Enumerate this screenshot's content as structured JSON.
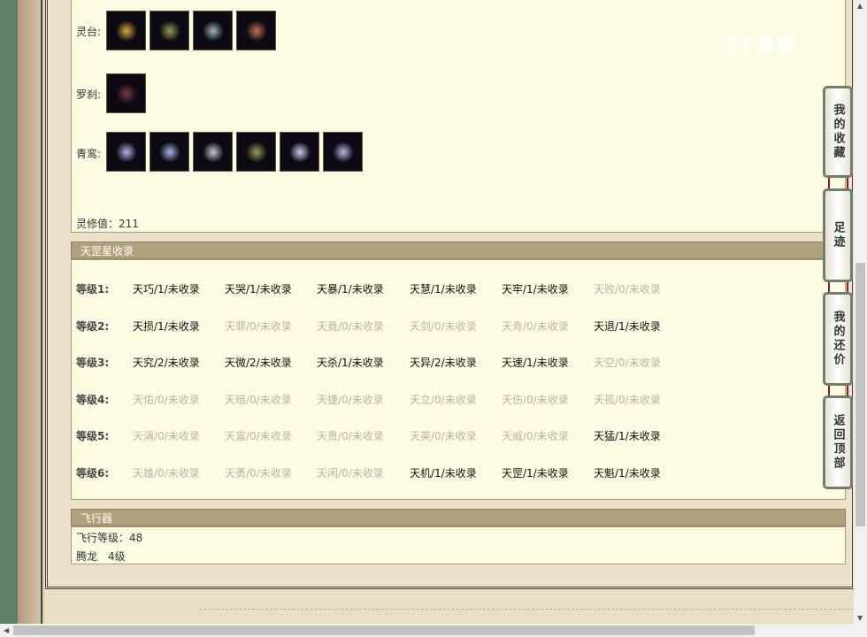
{
  "watermark": "CC直播",
  "lingtai": {
    "label": "灵台:",
    "icons": [
      "crown-icon",
      "mask-icon",
      "cloak-icon",
      "pendant-icon"
    ]
  },
  "luosha": {
    "label": "罗刹:",
    "icons": [
      "bag-icon"
    ]
  },
  "qingluan": {
    "label": "青鸾:",
    "icons": [
      "wing-icon",
      "robe-icon",
      "ring-icon",
      "mask-icon",
      "tassel-icon",
      "belt-icon"
    ]
  },
  "lingxiu": "灵修值：211",
  "tiangang": {
    "title": "天罡星收录",
    "rows": [
      {
        "label": "等级1:",
        "cells": [
          {
            "t": "天巧/1/未收录",
            "c": 1
          },
          {
            "t": "天哭/1/未收录",
            "c": 1
          },
          {
            "t": "天暴/1/未收录",
            "c": 1
          },
          {
            "t": "天慧/1/未收录",
            "c": 1
          },
          {
            "t": "天牢/1/未收录",
            "c": 1
          },
          {
            "t": "天败/0/未收录",
            "c": 0
          }
        ]
      },
      {
        "label": "等级2:",
        "cells": [
          {
            "t": "天损/1/未收录",
            "c": 1
          },
          {
            "t": "天罪/0/未收录",
            "c": 0
          },
          {
            "t": "天竟/0/未收录",
            "c": 0
          },
          {
            "t": "天剑/0/未收录",
            "c": 0
          },
          {
            "t": "天寿/0/未收录",
            "c": 0
          },
          {
            "t": "天退/1/未收录",
            "c": 1
          }
        ]
      },
      {
        "label": "等级3:",
        "cells": [
          {
            "t": "天究/2/未收录",
            "c": 2
          },
          {
            "t": "天微/2/未收录",
            "c": 2
          },
          {
            "t": "天杀/1/未收录",
            "c": 1
          },
          {
            "t": "天异/2/未收录",
            "c": 2
          },
          {
            "t": "天速/1/未收录",
            "c": 1
          },
          {
            "t": "天空/0/未收录",
            "c": 0
          }
        ]
      },
      {
        "label": "等级4:",
        "cells": [
          {
            "t": "天佑/0/未收录",
            "c": 0
          },
          {
            "t": "天暗/0/未收录",
            "c": 0
          },
          {
            "t": "天捷/0/未收录",
            "c": 0
          },
          {
            "t": "天立/0/未收录",
            "c": 0
          },
          {
            "t": "天伤/0/未收录",
            "c": 0
          },
          {
            "t": "天孤/0/未收录",
            "c": 0
          }
        ]
      },
      {
        "label": "等级5:",
        "cells": [
          {
            "t": "天满/0/未收录",
            "c": 0
          },
          {
            "t": "天富/0/未收录",
            "c": 0
          },
          {
            "t": "天贵/0/未收录",
            "c": 0
          },
          {
            "t": "天英/0/未收录",
            "c": 0
          },
          {
            "t": "天威/0/未收录",
            "c": 0
          },
          {
            "t": "天猛/1/未收录",
            "c": 1
          }
        ]
      },
      {
        "label": "等级6:",
        "cells": [
          {
            "t": "天雄/0/未收录",
            "c": 0
          },
          {
            "t": "天勇/0/未收录",
            "c": 0
          },
          {
            "t": "天闲/0/未收录",
            "c": 0
          },
          {
            "t": "天机/1/未收录",
            "c": 1
          },
          {
            "t": "天罡/1/未收录",
            "c": 1
          },
          {
            "t": "天魁/1/未收录",
            "c": 1
          }
        ]
      }
    ]
  },
  "flyer": {
    "title": "飞行器",
    "level": "飞行等级：48",
    "mount": "腾龙　4级"
  },
  "side": [
    "我的收藏",
    "足迹",
    "我的还价",
    "返回顶部"
  ]
}
